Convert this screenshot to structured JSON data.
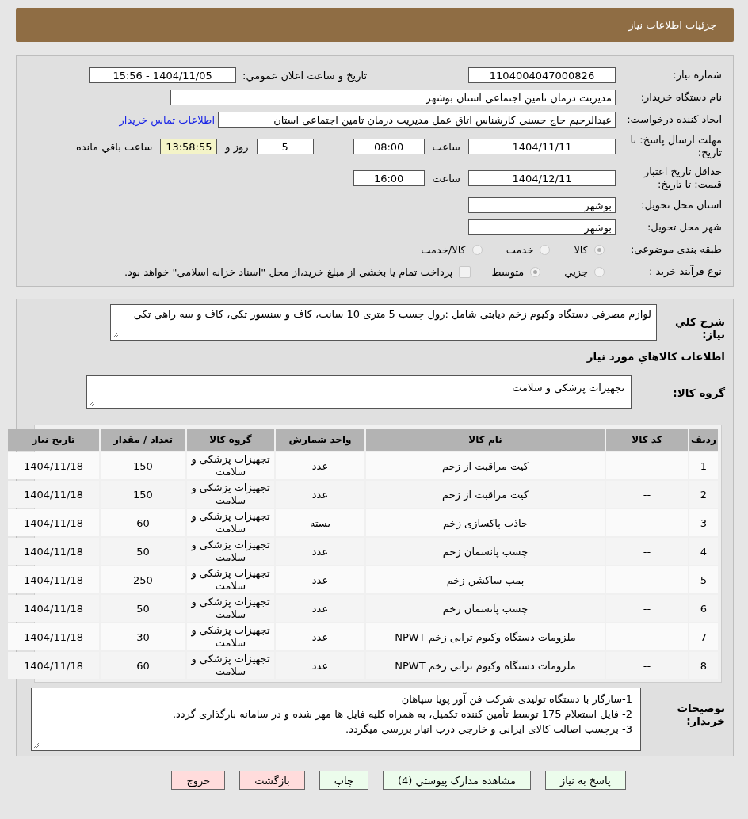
{
  "header": {
    "title": "جزئیات اطلاعات نیاز"
  },
  "need_number": {
    "label": "شماره نیاز:",
    "value": "1104004047000826"
  },
  "announce": {
    "label": "تاریخ و ساعت اعلان عمومي:",
    "value": "1404/11/05 - 15:56"
  },
  "buyer": {
    "label": "نام دستگاه خریدار:",
    "value": "مدیریت درمان تامین اجتماعی استان بوشهر"
  },
  "creator": {
    "label": "ایجاد کننده درخواست:",
    "value": "عبدالرحیم حاج حسنی کارشناس اتاق عمل مدیریت درمان تامین اجتماعی استان",
    "link": "اطلاعات تماس خریدار"
  },
  "deadline": {
    "label": "مهلت ارسال پاسخ: تا تاریخ:",
    "date": "1404/11/11",
    "time_label": "ساعت",
    "time": "08:00",
    "days": "5",
    "days_label": "روز و",
    "remaining": "13:58:55",
    "remaining_label": "ساعت باقي مانده"
  },
  "validity": {
    "label": "حداقل تاریخ اعتبار قیمت: تا تاریخ:",
    "date": "1404/12/11",
    "time_label": "ساعت",
    "time": "16:00"
  },
  "province": {
    "label": "استان محل تحویل:",
    "value": "بوشهر"
  },
  "city": {
    "label": "شهر محل تحویل:",
    "value": "بوشهر"
  },
  "category": {
    "label": "طبقه بندی موضوعی:",
    "options": [
      {
        "label": "کالا",
        "selected": true
      },
      {
        "label": "خدمت",
        "selected": false
      },
      {
        "label": "کالا/خدمت",
        "selected": false
      }
    ]
  },
  "process": {
    "label": "نوع فرآیند خرید :",
    "options": [
      {
        "label": "جزيي",
        "selected": false
      },
      {
        "label": "متوسط",
        "selected": true
      }
    ],
    "treasury": {
      "label": "پرداخت تمام یا بخشی از مبلغ خرید،از محل \"اسناد خزانه اسلامی\" خواهد بود.",
      "checked": false
    }
  },
  "description": {
    "label": "شرح کلي نیاز:",
    "value": "لوازم مصرفی دستگاه وکیوم زخم دیابتی شامل :رول چسب 5 متری 10 سانت، کاف و سنسور تکی، کاف و سه راهی تکی"
  },
  "goods_heading": "اطلاعات کالاهاي مورد نیاز",
  "goods_group": {
    "label": "گروه کالا:",
    "value": "تجهیزات پزشکی و سلامت"
  },
  "table": {
    "columns": [
      "ردیف",
      "کد کالا",
      "نام کالا",
      "واحد شمارش",
      "گروه کالا",
      "تعداد / مقدار",
      "تاریخ نیاز"
    ],
    "rows": [
      [
        "1",
        "--",
        "کیت مراقبت از زخم",
        "عدد",
        "تجهیزات پزشکی و سلامت",
        "150",
        "1404/11/18"
      ],
      [
        "2",
        "--",
        "کیت مراقبت از زخم",
        "عدد",
        "تجهیزات پزشکی و سلامت",
        "150",
        "1404/11/18"
      ],
      [
        "3",
        "--",
        "جاذب پاکسازی زخم",
        "بسته",
        "تجهیزات پزشکی و سلامت",
        "60",
        "1404/11/18"
      ],
      [
        "4",
        "--",
        "چسب پانسمان زخم",
        "عدد",
        "تجهیزات پزشکی و سلامت",
        "50",
        "1404/11/18"
      ],
      [
        "5",
        "--",
        "پمپ ساکشن زخم",
        "عدد",
        "تجهیزات پزشکی و سلامت",
        "250",
        "1404/11/18"
      ],
      [
        "6",
        "--",
        "چسب پانسمان زخم",
        "عدد",
        "تجهیزات پزشکی و سلامت",
        "50",
        "1404/11/18"
      ],
      [
        "7",
        "--",
        "ملزومات دستگاه وکیوم ترابی زخم NPWT",
        "عدد",
        "تجهیزات پزشکی و سلامت",
        "30",
        "1404/11/18"
      ],
      [
        "8",
        "--",
        "ملزومات دستگاه وکیوم ترابی زخم NPWT",
        "عدد",
        "تجهیزات پزشکی و سلامت",
        "60",
        "1404/11/18"
      ]
    ]
  },
  "notes": {
    "label": "توضیحات خریدار:",
    "lines": [
      "1-سازگار با دستگاه تولیدی شرکت فن آور پویا سپاهان",
      "2- فایل استعلام 175 توسط تأمین کننده تکمیل، به همراه کلیه فایل ها مهر شده و در سامانه بارگذاری گردد.",
      "3- برچسب اصالت کالای ایرانی و خارجی درب انبار بررسی میگردد."
    ]
  },
  "buttons": [
    {
      "label": "پاسخ به نیاز",
      "kind": "action"
    },
    {
      "label": "مشاهده مدارک پیوستي (4)",
      "kind": "action"
    },
    {
      "label": "چاپ",
      "kind": "action"
    },
    {
      "label": "بازگشت",
      "kind": "danger"
    },
    {
      "label": "خروج",
      "kind": "danger"
    }
  ]
}
